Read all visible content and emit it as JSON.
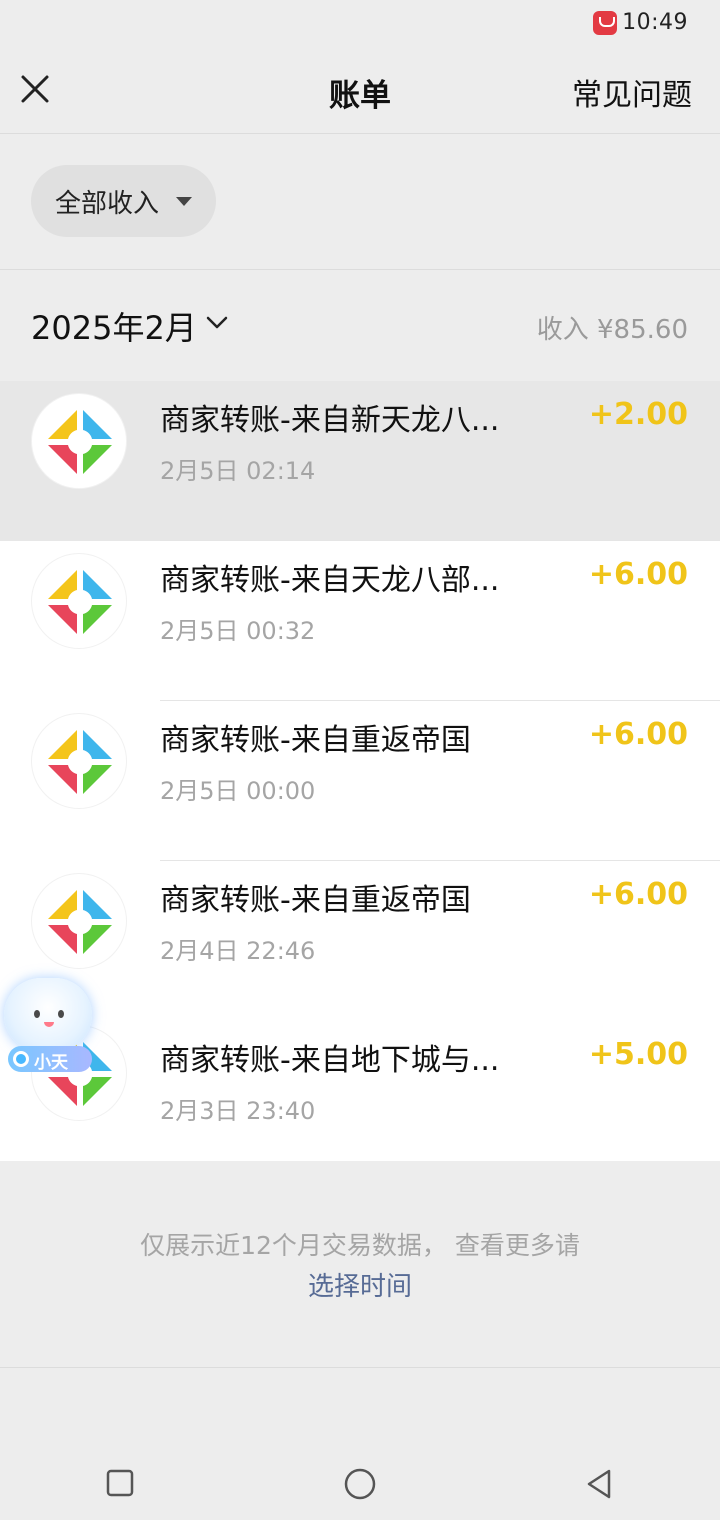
{
  "status_bar": {
    "time": "10:49"
  },
  "header": {
    "title": "账单",
    "faq_label": "常见问题"
  },
  "filter": {
    "label": "全部收入"
  },
  "month": {
    "label": "2025年2月",
    "income_summary": "收入 ¥85.60"
  },
  "transactions": [
    {
      "title": "商家转账-来自新天龙八...",
      "time": "2月5日 02:14",
      "amount": "+2.00"
    },
    {
      "title": "商家转账-来自天龙八部...",
      "time": "2月5日 00:32",
      "amount": "+6.00"
    },
    {
      "title": "商家转账-来自重返帝国",
      "time": "2月5日 00:00",
      "amount": "+6.00"
    },
    {
      "title": "商家转账-来自重返帝国",
      "time": "2月4日 22:46",
      "amount": "+6.00"
    },
    {
      "title": "商家转账-来自地下城与...",
      "time": "2月3日 23:40",
      "amount": "+5.00"
    }
  ],
  "assistant": {
    "label": "小天"
  },
  "notice": {
    "text": "仅展示近12个月交易数据， 查看更多请",
    "link": "选择时间"
  },
  "colors": {
    "amount": "#f0c419",
    "link": "#576b95",
    "background": "#ededed"
  },
  "icons": {
    "close": "close-icon",
    "merchant": "merchant-logo-icon",
    "nav": [
      "recents-square-icon",
      "home-circle-icon",
      "back-triangle-icon"
    ]
  }
}
